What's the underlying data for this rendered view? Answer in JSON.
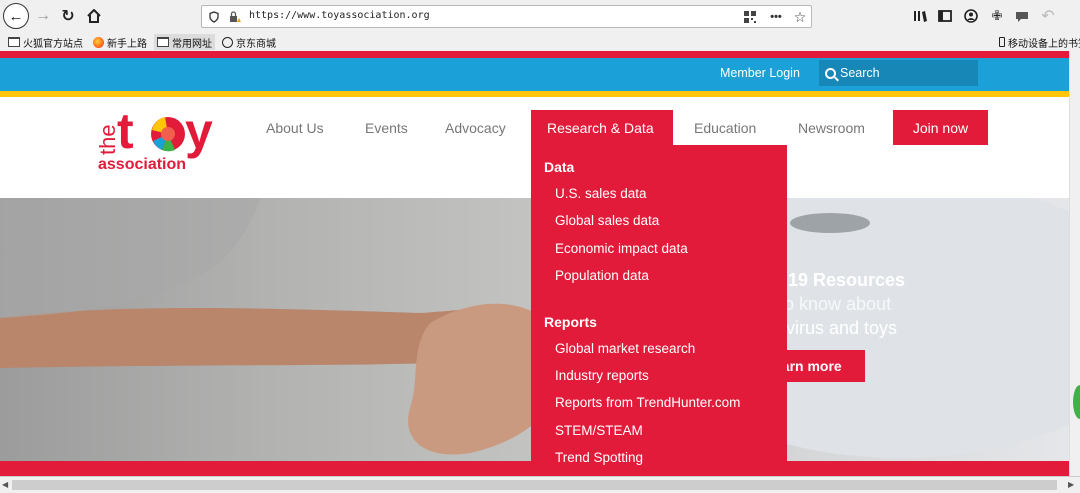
{
  "browser": {
    "url": "https://www.toyassociation.org",
    "bookmarks": [
      "火狐官方站点",
      "新手上路",
      "常用网址",
      "京东商城"
    ],
    "mobile_bookmarks": "移动设备上的书签"
  },
  "site": {
    "member_login": "Member Login",
    "search_placeholder": "Search",
    "logo": {
      "the": "the",
      "toy": "toy",
      "association": "association"
    },
    "nav": [
      "About Us",
      "Events",
      "Advocacy",
      "Research & Data",
      "Education",
      "Newsroom"
    ],
    "join_label": "Join now",
    "dropdown": {
      "sections": [
        {
          "title": "Data",
          "links": [
            "U.S. sales data",
            "Global sales data",
            "Economic impact data",
            "Population data"
          ]
        },
        {
          "title": "Reports",
          "links": [
            "Global market research",
            "Industry reports",
            "Reports from TrendHunter.com",
            "STEM/STEAM",
            "Trend Spotting"
          ]
        }
      ]
    },
    "hero": {
      "line1": "19 Resources",
      "line2": "o know about",
      "line3": "virus and toys",
      "cta": "earn more"
    }
  },
  "colors": {
    "brand_red": "#e31b3a",
    "brand_blue": "#1ba1d8",
    "brand_yellow": "#ffc60b"
  }
}
